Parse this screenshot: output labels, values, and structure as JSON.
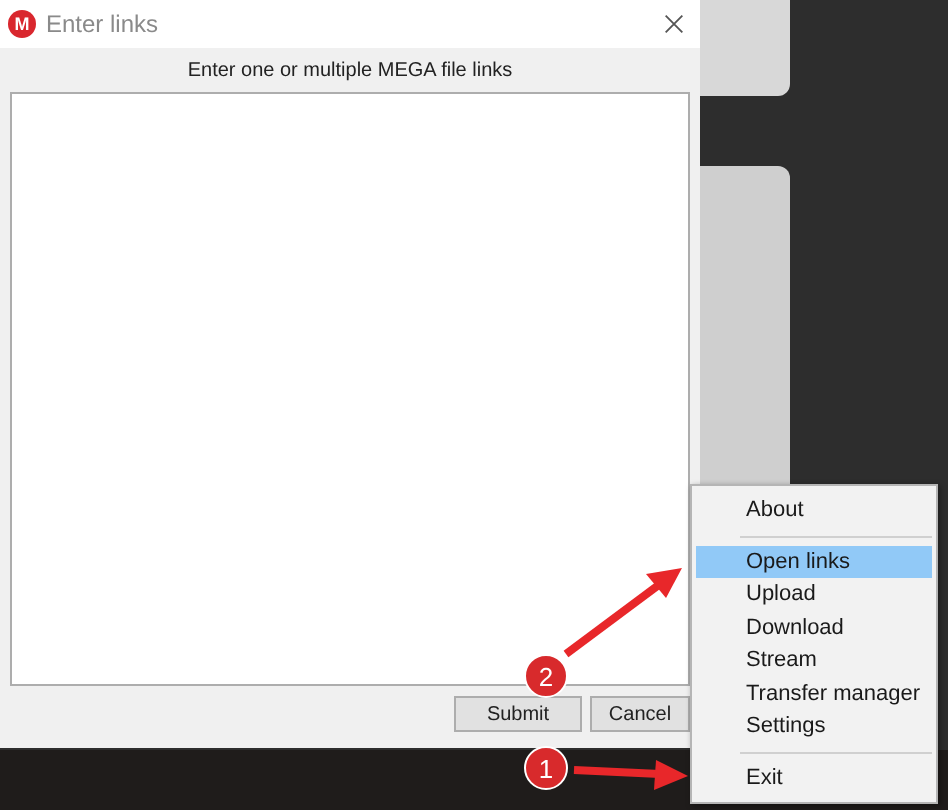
{
  "dialog": {
    "logo_letter": "M",
    "title": "Enter links",
    "prompt": "Enter one or multiple MEGA file links",
    "buttons": [
      {
        "label": "Submit"
      },
      {
        "label": "Cancel"
      }
    ]
  },
  "context_menu": {
    "groups": [
      [
        {
          "label": "About",
          "selected": false
        }
      ],
      [
        {
          "label": "Open links",
          "selected": true
        },
        {
          "label": "Upload",
          "selected": false
        },
        {
          "label": "Download",
          "selected": false
        },
        {
          "label": "Stream",
          "selected": false
        },
        {
          "label": "Transfer manager",
          "selected": false
        },
        {
          "label": "Settings",
          "selected": false
        }
      ],
      [
        {
          "label": "Exit",
          "selected": false
        }
      ]
    ]
  },
  "callouts": [
    {
      "label": "2"
    },
    {
      "label": "1"
    }
  ]
}
